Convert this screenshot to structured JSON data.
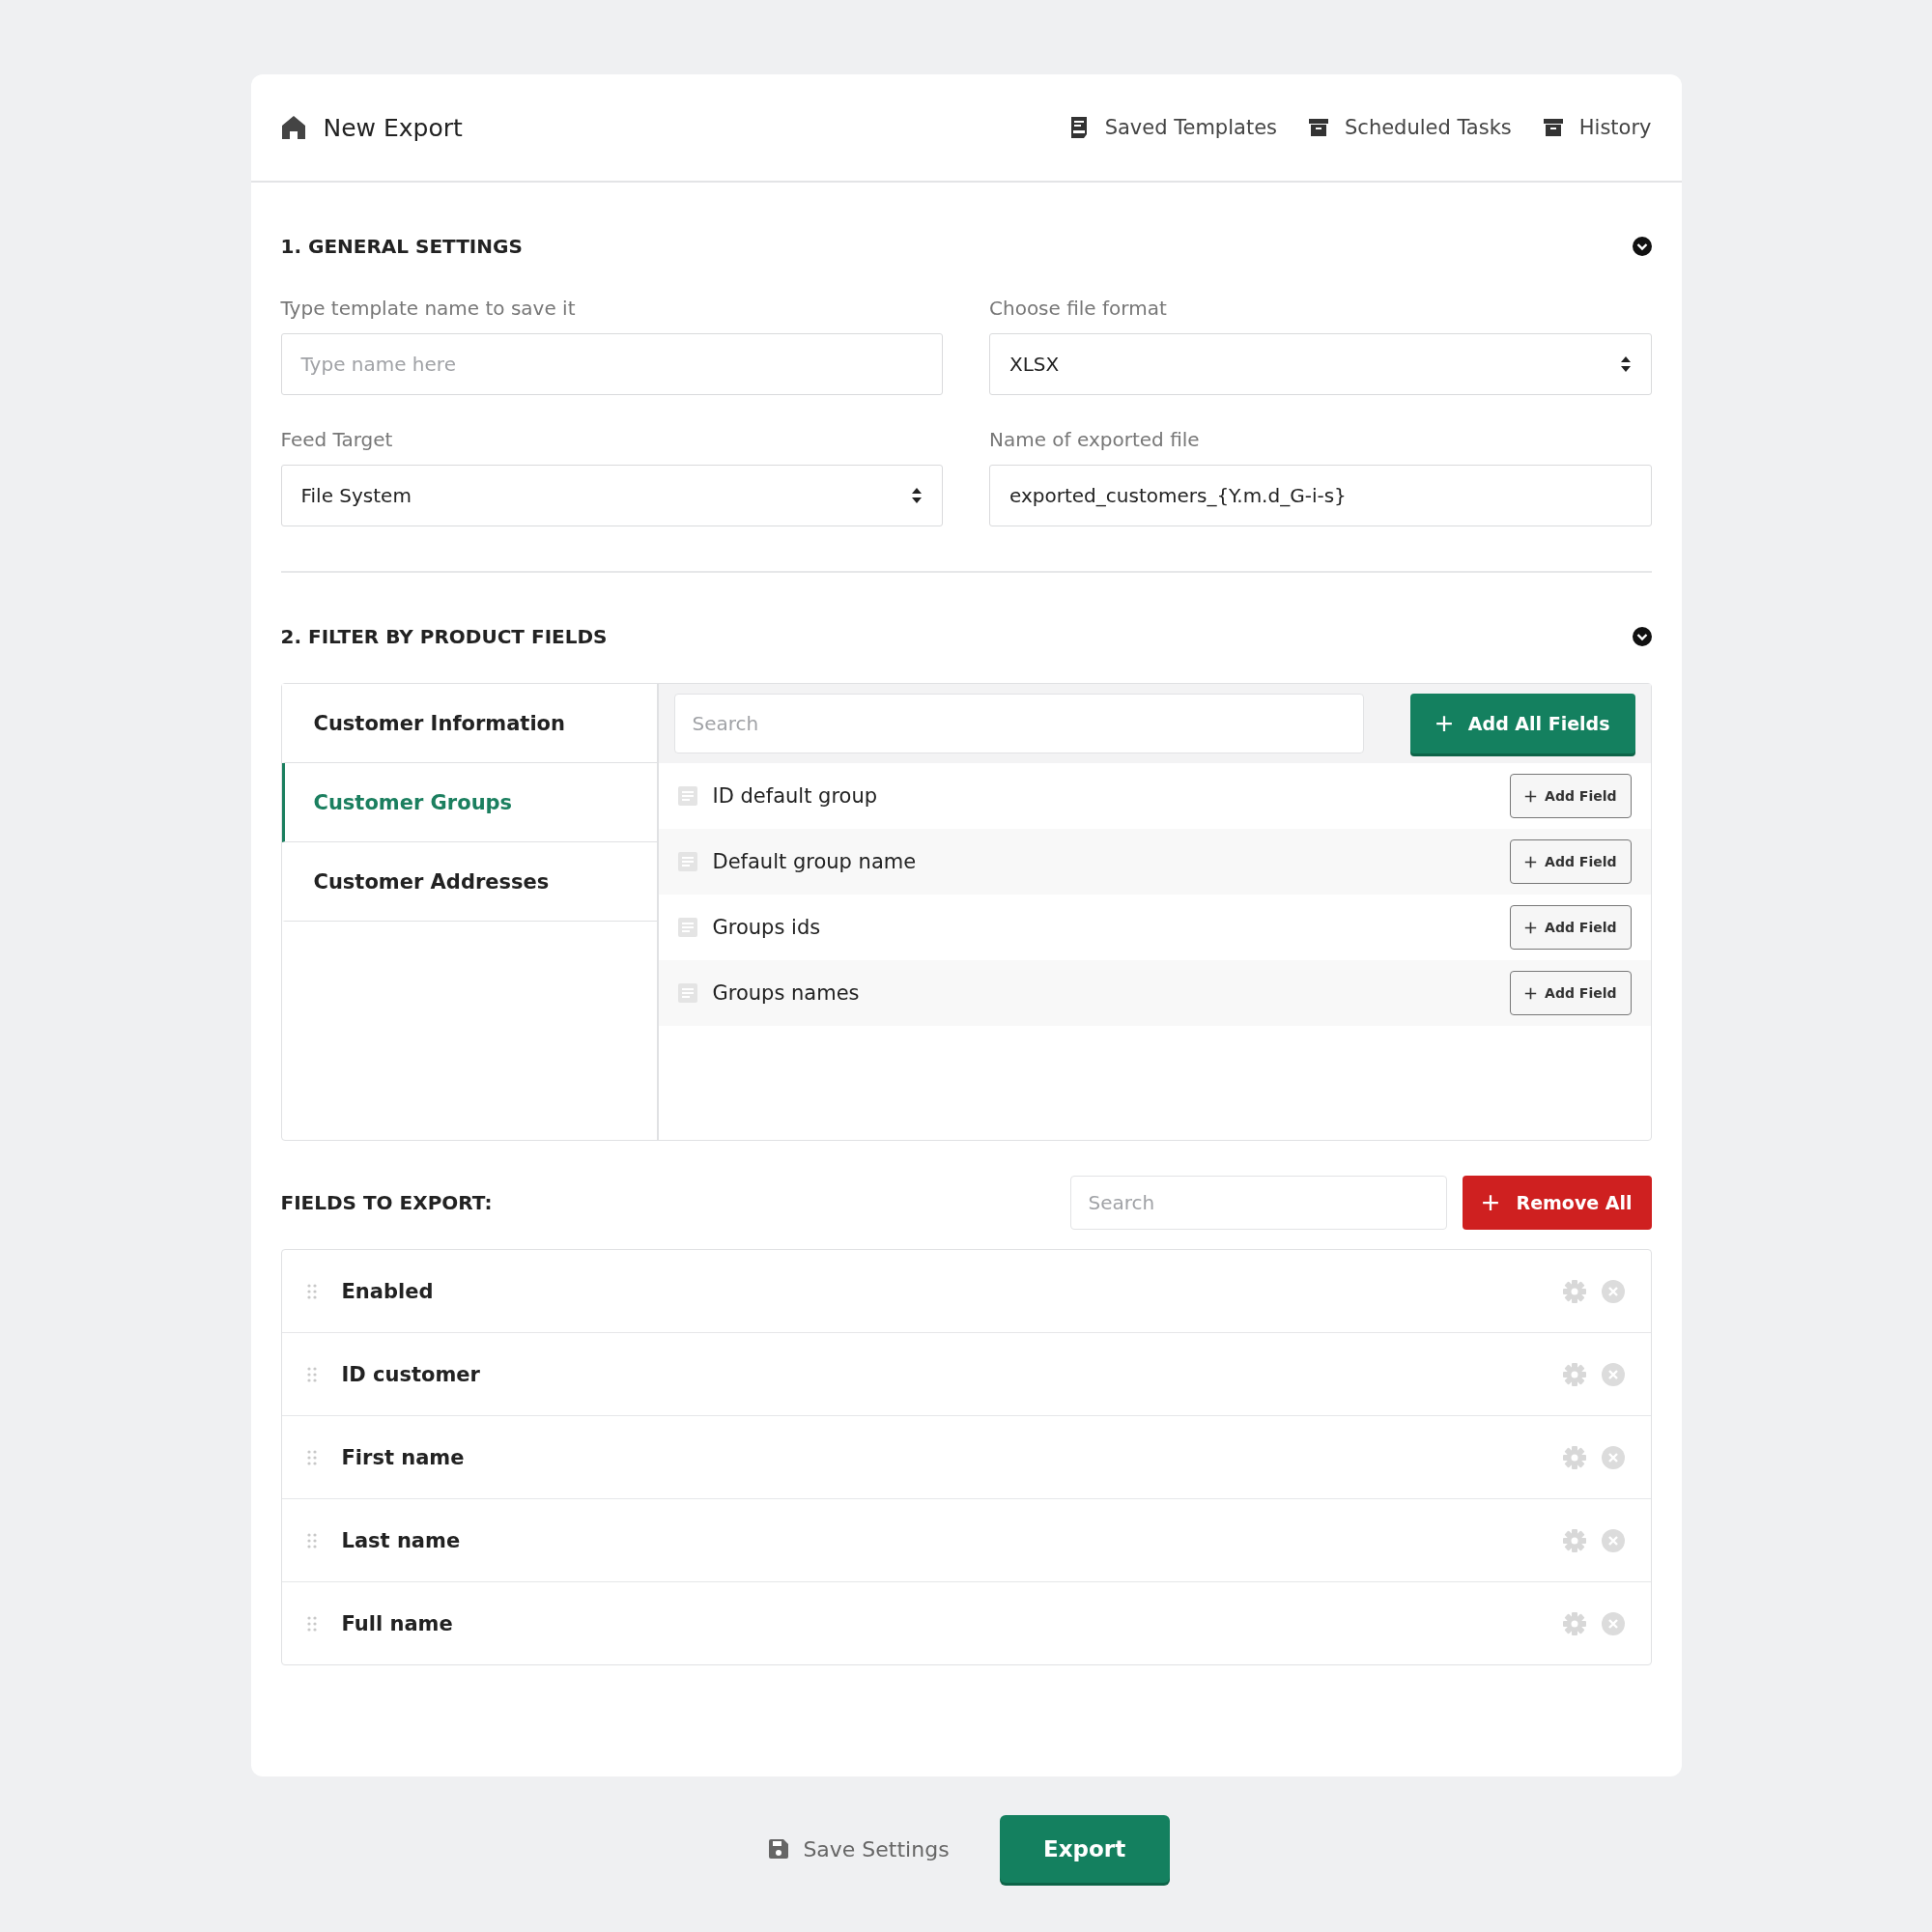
{
  "header": {
    "title": "New Export",
    "nav": [
      {
        "label": "Saved Templates",
        "kind": "template"
      },
      {
        "label": "Scheduled Tasks",
        "kind": "archive"
      },
      {
        "label": "History",
        "kind": "archive"
      }
    ]
  },
  "general_settings": {
    "title": "1. GENERAL SETTINGS",
    "fields": [
      {
        "label": "Type template name to save it",
        "kind": "text",
        "placeholder": "Type name here"
      },
      {
        "label": "Choose file format",
        "kind": "select",
        "value": "XLSX"
      },
      {
        "label": "Feed Target",
        "kind": "select",
        "value": "File System"
      },
      {
        "label": "Name of exported file",
        "kind": "text",
        "value": "exported_customers_{Y.m.d_G-i-s}"
      }
    ]
  },
  "filter": {
    "title": "2. FILTER BY PRODUCT FIELDS",
    "tabs": [
      {
        "label": "Customer Information",
        "selected": false
      },
      {
        "label": "Customer Groups",
        "selected": true
      },
      {
        "label": "Customer Addresses",
        "selected": false
      }
    ],
    "search": {
      "placeholder": "Search"
    },
    "add_all_button": "Add All Fields",
    "fields": [
      {
        "name": "ID default group",
        "button": "Add Field"
      },
      {
        "name": "Default group name",
        "button": "Add Field"
      },
      {
        "name": "Groups ids",
        "button": "Add Field"
      },
      {
        "name": "Groups names",
        "button": "Add Field"
      }
    ]
  },
  "export_fields": {
    "title": "FIELDS TO EXPORT:",
    "search": {
      "placeholder": "Search"
    },
    "remove_all_button": "Remove All",
    "rows": [
      {
        "name": "Enabled"
      },
      {
        "name": "ID customer"
      },
      {
        "name": "First name"
      },
      {
        "name": "Last name"
      },
      {
        "name": "Full name"
      }
    ]
  },
  "footer": {
    "save_button": "Save Settings",
    "export_button": "Export"
  }
}
